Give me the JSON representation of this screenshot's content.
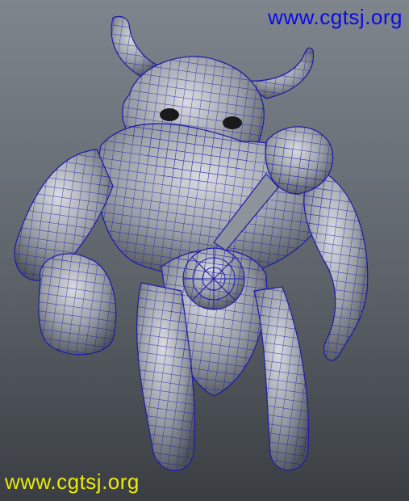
{
  "watermarks": {
    "top": "www.cgtsj.org",
    "bottom": "www.cgtsj.org"
  },
  "colors": {
    "background_top": "#7f858d",
    "background_bottom": "#3a3e43",
    "mesh_fill": "#9a9ea6",
    "wireframe": "#1c1ca8",
    "watermark_top": "#0a0ae8",
    "watermark_bottom": "#e9e90a"
  },
  "subject": {
    "icon": "minotaur-wireframe-model"
  }
}
